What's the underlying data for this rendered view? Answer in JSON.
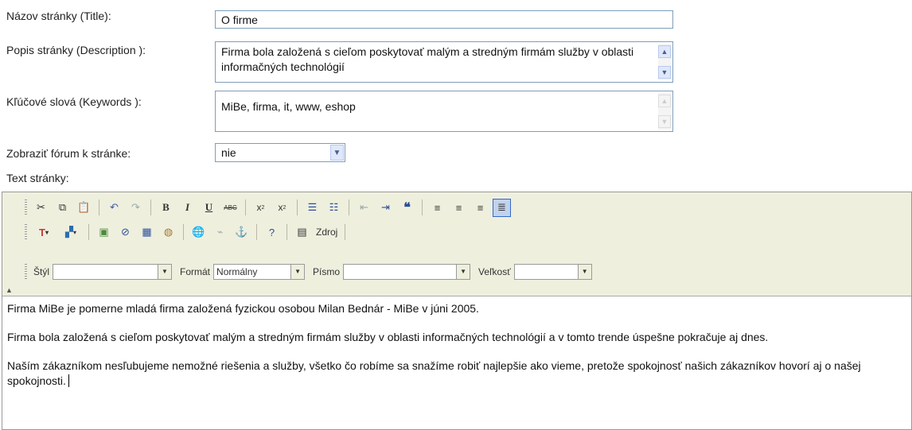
{
  "form": {
    "title_label": "Názov stránky (Title):",
    "title_value": "O firme",
    "description_label": "Popis stránky (Description ):",
    "description_value": "Firma bola založená s cieľom poskytovať malým a stredným firmám služby v oblasti informačných technológií",
    "keywords_label": "Kľúčové slová (Keywords ):",
    "keywords_value": "MiBe, firma, it, www, eshop",
    "forum_label": "Zobraziť fórum k stránke:",
    "forum_value": "nie",
    "text_label": "Text stránky:"
  },
  "toolbar": {
    "source_label": "Zdroj",
    "style_label": "Štýl",
    "style_value": "",
    "format_label": "Formát",
    "format_value": "Normálny",
    "font_label": "Písmo",
    "font_value": "",
    "size_label": "Veľkosť",
    "size_value": ""
  },
  "content": {
    "paragraphs": [
      "Firma MiBe je pomerne mladá firma založená fyzickou osobou Milan Bednár - MiBe v júni 2005.",
      "Firma bola založená s cieľom poskytovať malým a stredným firmám služby v oblasti informačných technológií a v tomto trende úspešne pokračuje aj dnes.",
      "Naším zákazníkom nesľubujeme nemožné riešenia a služby, všetko čo robíme sa snažíme robiť najlepšie ako vieme, pretože spokojnosť našich zákazníkov hovorí aj o našej spokojnosti."
    ]
  },
  "colors": {
    "field_border": "#7f9db9",
    "toolbar_bg": "#efefde",
    "active_button": "#c1d2ee"
  }
}
